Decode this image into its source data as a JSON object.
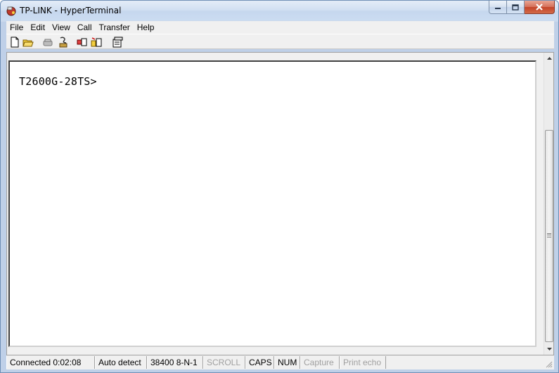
{
  "window": {
    "title": "TP-LINK - HyperTerminal"
  },
  "menubar": {
    "items": [
      "File",
      "Edit",
      "View",
      "Call",
      "Transfer",
      "Help"
    ]
  },
  "toolbar": {
    "icons": [
      "new-icon",
      "open-icon",
      "disconnect-icon",
      "dial-icon",
      "send-icon",
      "receive-icon",
      "properties-icon"
    ]
  },
  "terminal": {
    "prompt": "T2600G-28TS>"
  },
  "statusbar": {
    "connection": "Connected 0:02:08",
    "detect": "Auto detect",
    "settings": "38400 8-N-1",
    "scroll": "SCROLL",
    "caps": "CAPS",
    "num": "NUM",
    "capture": "Capture",
    "print_echo": "Print echo"
  },
  "colors": {
    "titlebar": "#c6d7ee",
    "close_button": "#c4442a",
    "chrome": "#f0f0f0",
    "terminal_bg": "#ffffff"
  }
}
